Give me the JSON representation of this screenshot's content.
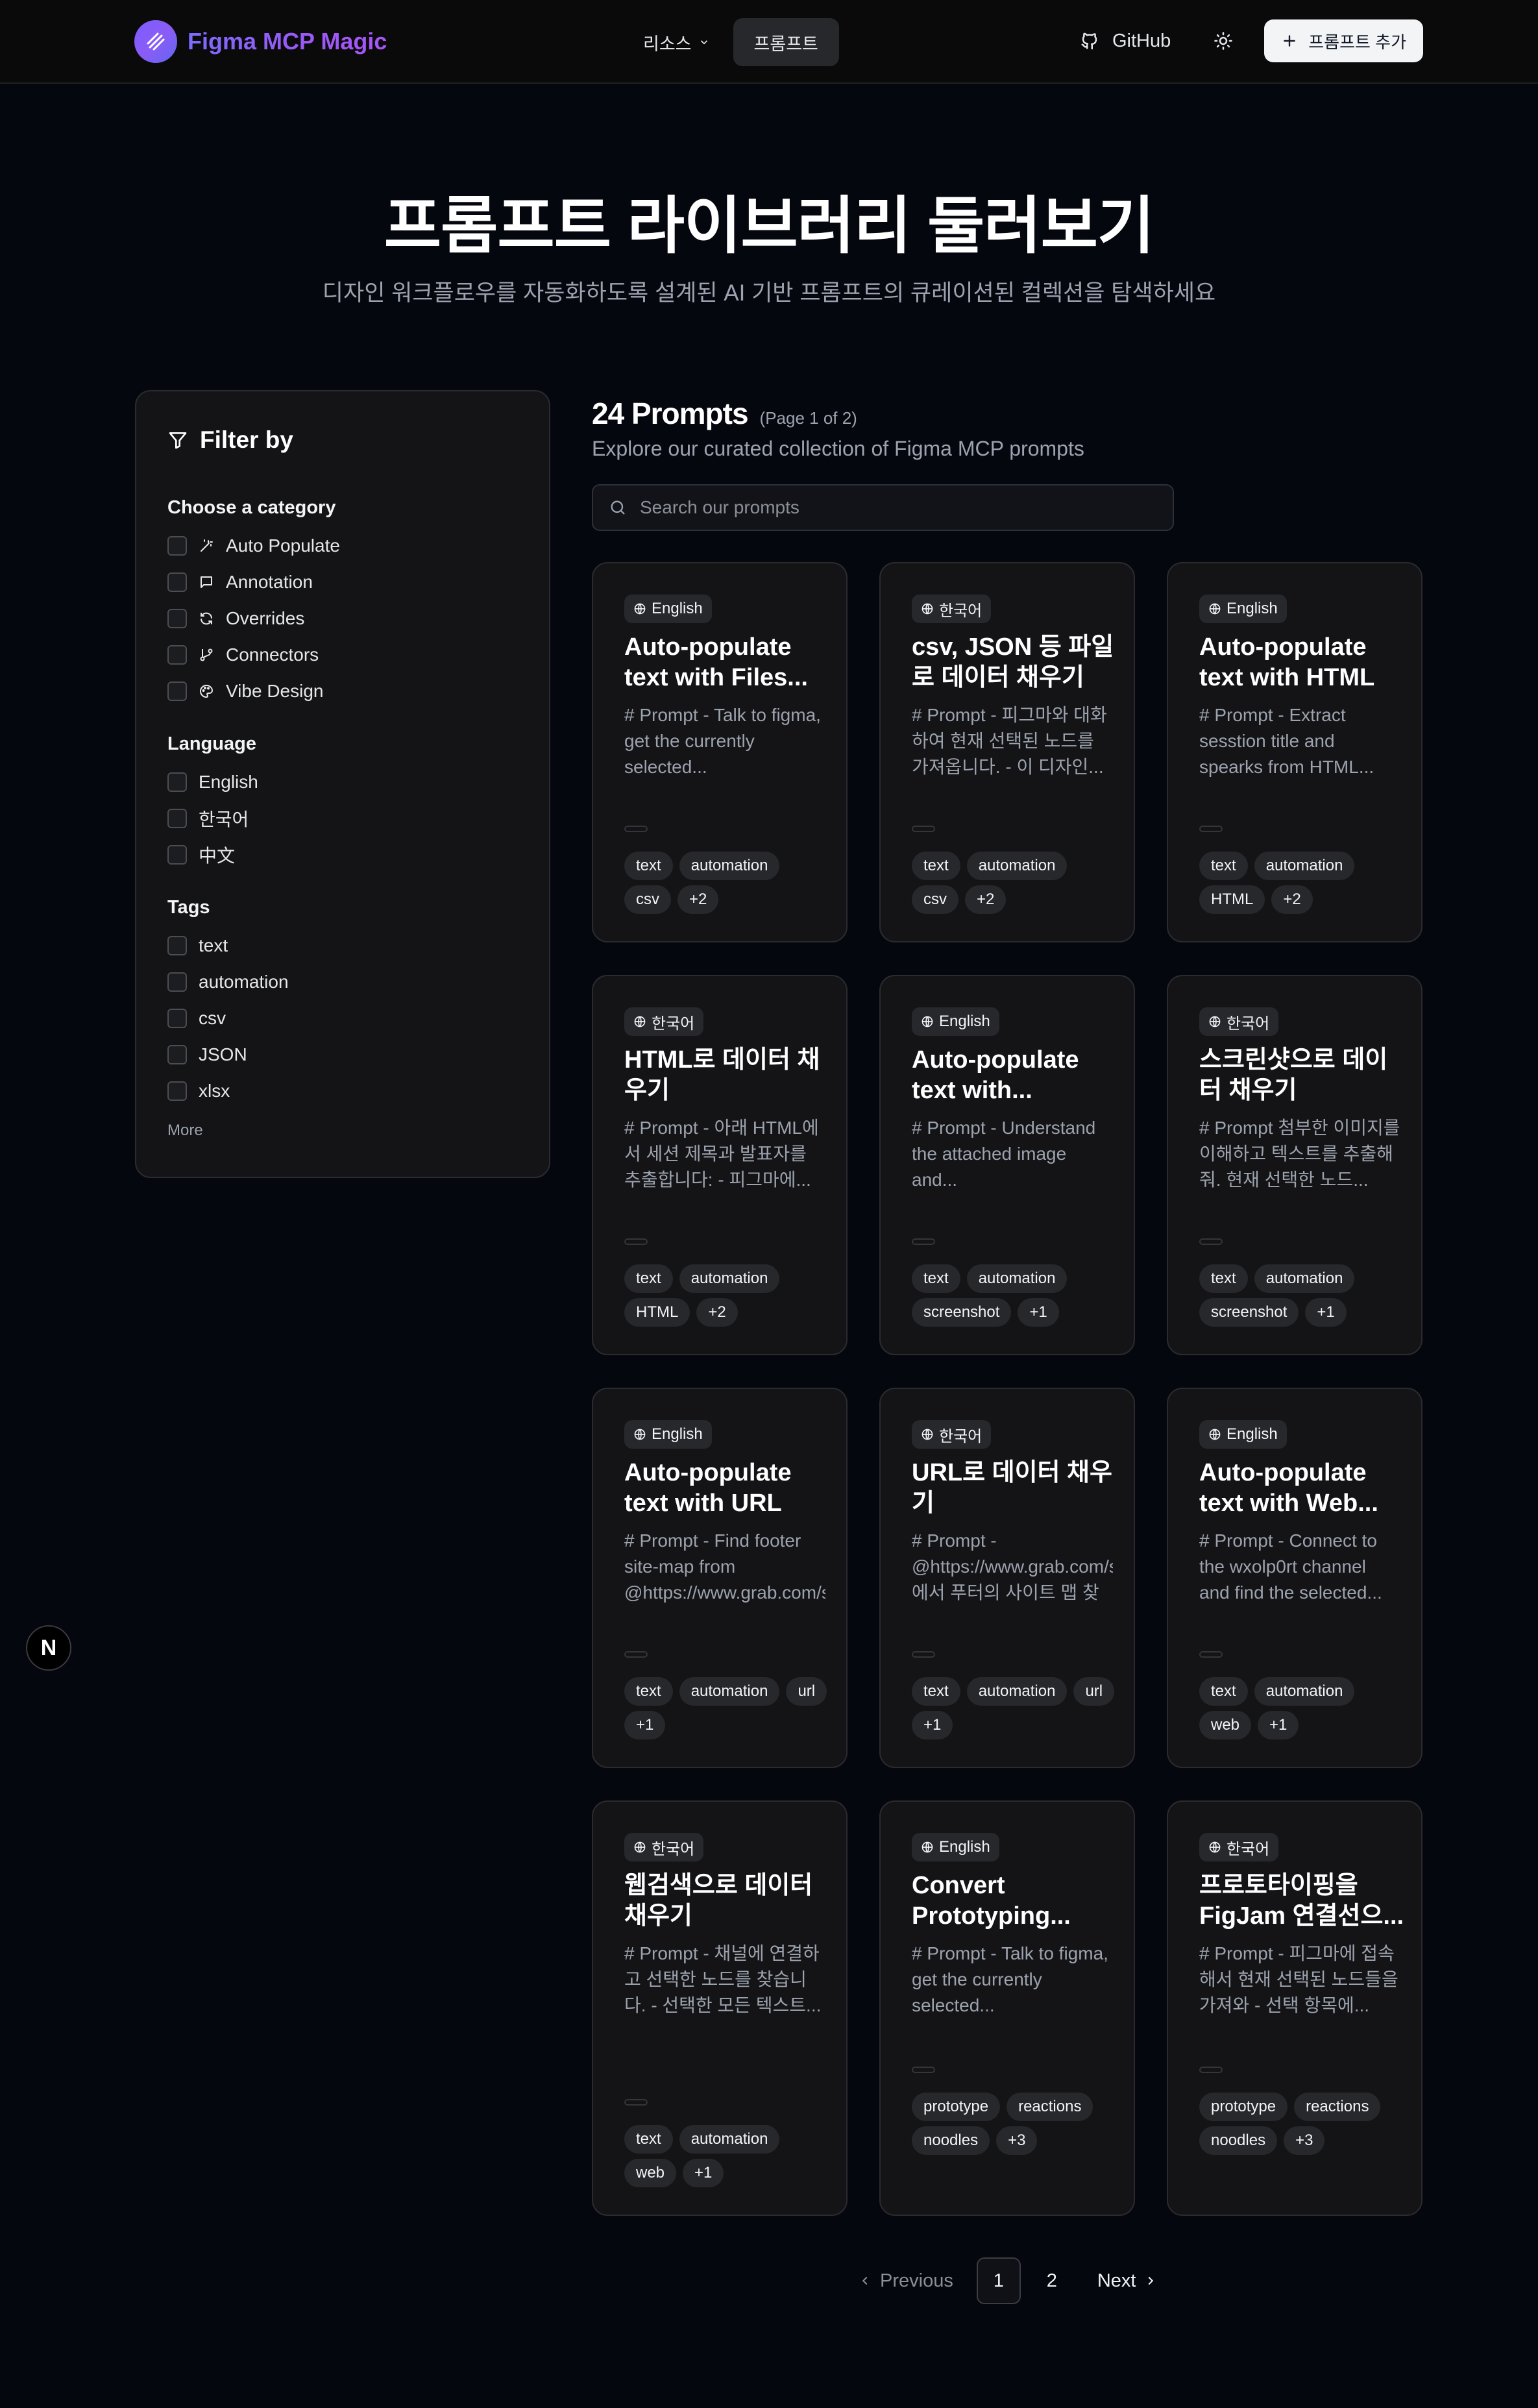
{
  "header": {
    "app_name": "Figma MCP Magic",
    "nav": [
      {
        "label": "리소스",
        "has_dropdown": true
      },
      {
        "label": "프롬프트",
        "active": true
      }
    ],
    "github_label": "GitHub",
    "add_prompt_label": "프롬프트 추가"
  },
  "hero": {
    "title": "프롬프트 라이브러리 둘러보기",
    "subtitle": "디자인 워크플로우를 자동화하도록 설계된 AI 기반 프롬프트의 큐레이션된 컬렉션을 탐색하세요"
  },
  "sidebar": {
    "title": "Filter by",
    "category_title": "Choose a category",
    "categories": [
      {
        "label": "Auto Populate",
        "icon": "wand-icon"
      },
      {
        "label": "Annotation",
        "icon": "message-square-icon"
      },
      {
        "label": "Overrides",
        "icon": "refresh-icon"
      },
      {
        "label": "Connectors",
        "icon": "git-branch-icon"
      },
      {
        "label": "Vibe Design",
        "icon": "palette-icon"
      }
    ],
    "language_title": "Language",
    "languages": [
      "English",
      "한국어",
      "中文"
    ],
    "tags_title": "Tags",
    "tags": [
      "text",
      "automation",
      "csv",
      "JSON",
      "xlsx"
    ],
    "more_label": "More"
  },
  "main": {
    "count": "24 Prompts",
    "page_info": "(Page 1 of 2)",
    "subtitle": "Explore our curated collection of Figma MCP prompts",
    "search_placeholder": "Search our prompts",
    "cards": [
      {
        "lang": "English",
        "title": "Auto-populate text with Files...",
        "desc": "# Prompt - Talk to figma, get the currently selected...",
        "tags": [
          "text",
          "automation",
          "csv",
          "+2"
        ]
      },
      {
        "lang": "한국어",
        "title": "csv, JSON 등 파일로 데이터 채우기",
        "desc": "# Prompt - 피그마와 대화하여 현재 선택된 노드를 가져옵니다. - 이 디자인...",
        "tags": [
          "text",
          "automation",
          "csv",
          "+2"
        ]
      },
      {
        "lang": "English",
        "title": "Auto-populate text with HTML",
        "desc": "# Prompt - Extract sesstion title and spearks from HTML...",
        "tags": [
          "text",
          "automation",
          "HTML",
          "+2"
        ]
      },
      {
        "lang": "한국어",
        "title": "HTML로 데이터 채우기",
        "desc": "# Prompt - 아래 HTML에서 세션 제목과 발표자를 추출합니다: - 피그마에...",
        "tags": [
          "text",
          "automation",
          "HTML",
          "+2"
        ]
      },
      {
        "lang": "English",
        "title": "Auto-populate text with...",
        "desc": "# Prompt - Understand the attached image and...",
        "tags": [
          "text",
          "automation",
          "screenshot",
          "+1"
        ]
      },
      {
        "lang": "한국어",
        "title": "스크린샷으로 데이터 채우기",
        "desc": "# Prompt 첨부한 이미지를 이해하고 텍스트를 추출해줘. 현재 선택한 노드...",
        "tags": [
          "text",
          "automation",
          "screenshot",
          "+1"
        ]
      },
      {
        "lang": "English",
        "title": "Auto-populate text with URL",
        "desc": "# Prompt - Find footer site-map from @https://www.grab.com/s...",
        "tags": [
          "text",
          "automation",
          "url",
          "+1"
        ]
      },
      {
        "lang": "한국어",
        "title": "URL로 데이터 채우기",
        "desc": "# Prompt - @https://www.grab.com/sg/에서 푸터의 사이트 맵 찾아줘 ...",
        "tags": [
          "text",
          "automation",
          "url",
          "+1"
        ]
      },
      {
        "lang": "English",
        "title": "Auto-populate text with Web...",
        "desc": "# Prompt - Connect to the wxolp0rt channel and find the selected...",
        "tags": [
          "text",
          "automation",
          "web",
          "+1"
        ]
      },
      {
        "lang": "한국어",
        "title": "웹검색으로 데이터 채우기",
        "desc": "# Prompt - 채널에 연결하고 선택한 노드를 찾습니다. - 선택한 모든 텍스트...",
        "tags": [
          "text",
          "automation",
          "web",
          "+1"
        ]
      },
      {
        "lang": "English",
        "title": "Convert Prototyping...",
        "desc": "# Prompt - Talk to figma, get the currently selected...",
        "tags": [
          "prototype",
          "reactions",
          "noodles",
          "+3"
        ]
      },
      {
        "lang": "한국어",
        "title": "프로토타이핑을 FigJam 연결선으...",
        "desc": "# Prompt - 피그마에 접속해서 현재 선택된 노드들을 가져와 - 선택 항목에...",
        "tags": [
          "prototype",
          "reactions",
          "noodles",
          "+3"
        ]
      }
    ]
  },
  "pagination": {
    "prev_label": "Previous",
    "pages": [
      "1",
      "2"
    ],
    "next_label": "Next"
  },
  "floating_badge": "N"
}
